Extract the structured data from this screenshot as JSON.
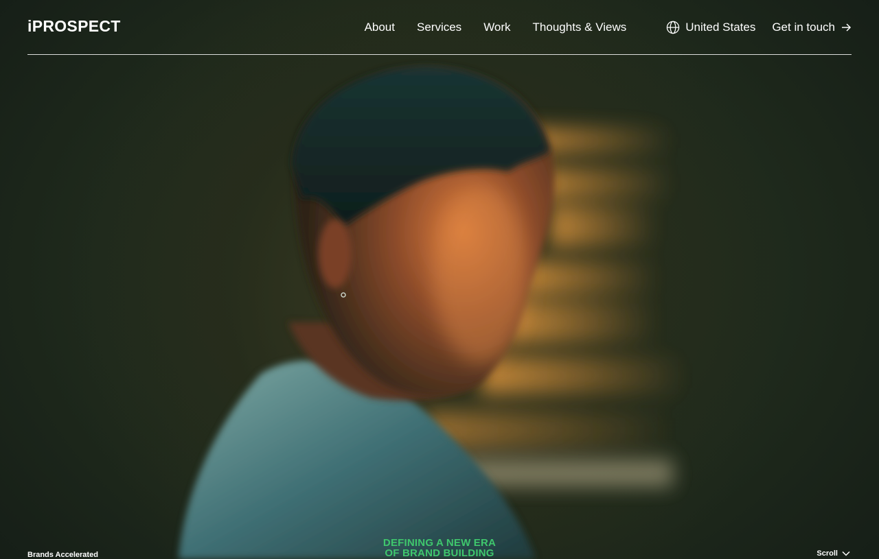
{
  "brand": {
    "logo_text": "iPROSPECT"
  },
  "nav": {
    "items": [
      {
        "label": "About"
      },
      {
        "label": "Services"
      },
      {
        "label": "Work"
      },
      {
        "label": "Thoughts & Views"
      }
    ]
  },
  "region": {
    "label": "United States",
    "icon": "globe-icon"
  },
  "cta": {
    "label": "Get in touch",
    "icon": "arrow-right-icon"
  },
  "hero": {
    "tagline": "Brands Accelerated",
    "headline_line1": "DEFINING A NEW ERA",
    "headline_line2": "OF BRAND BUILDING",
    "scroll_label": "Scroll",
    "scroll_icon": "chevron-down-icon"
  },
  "colors": {
    "accent": "#3fc76d",
    "background": "#1f2a1c",
    "text": "#ffffff"
  }
}
